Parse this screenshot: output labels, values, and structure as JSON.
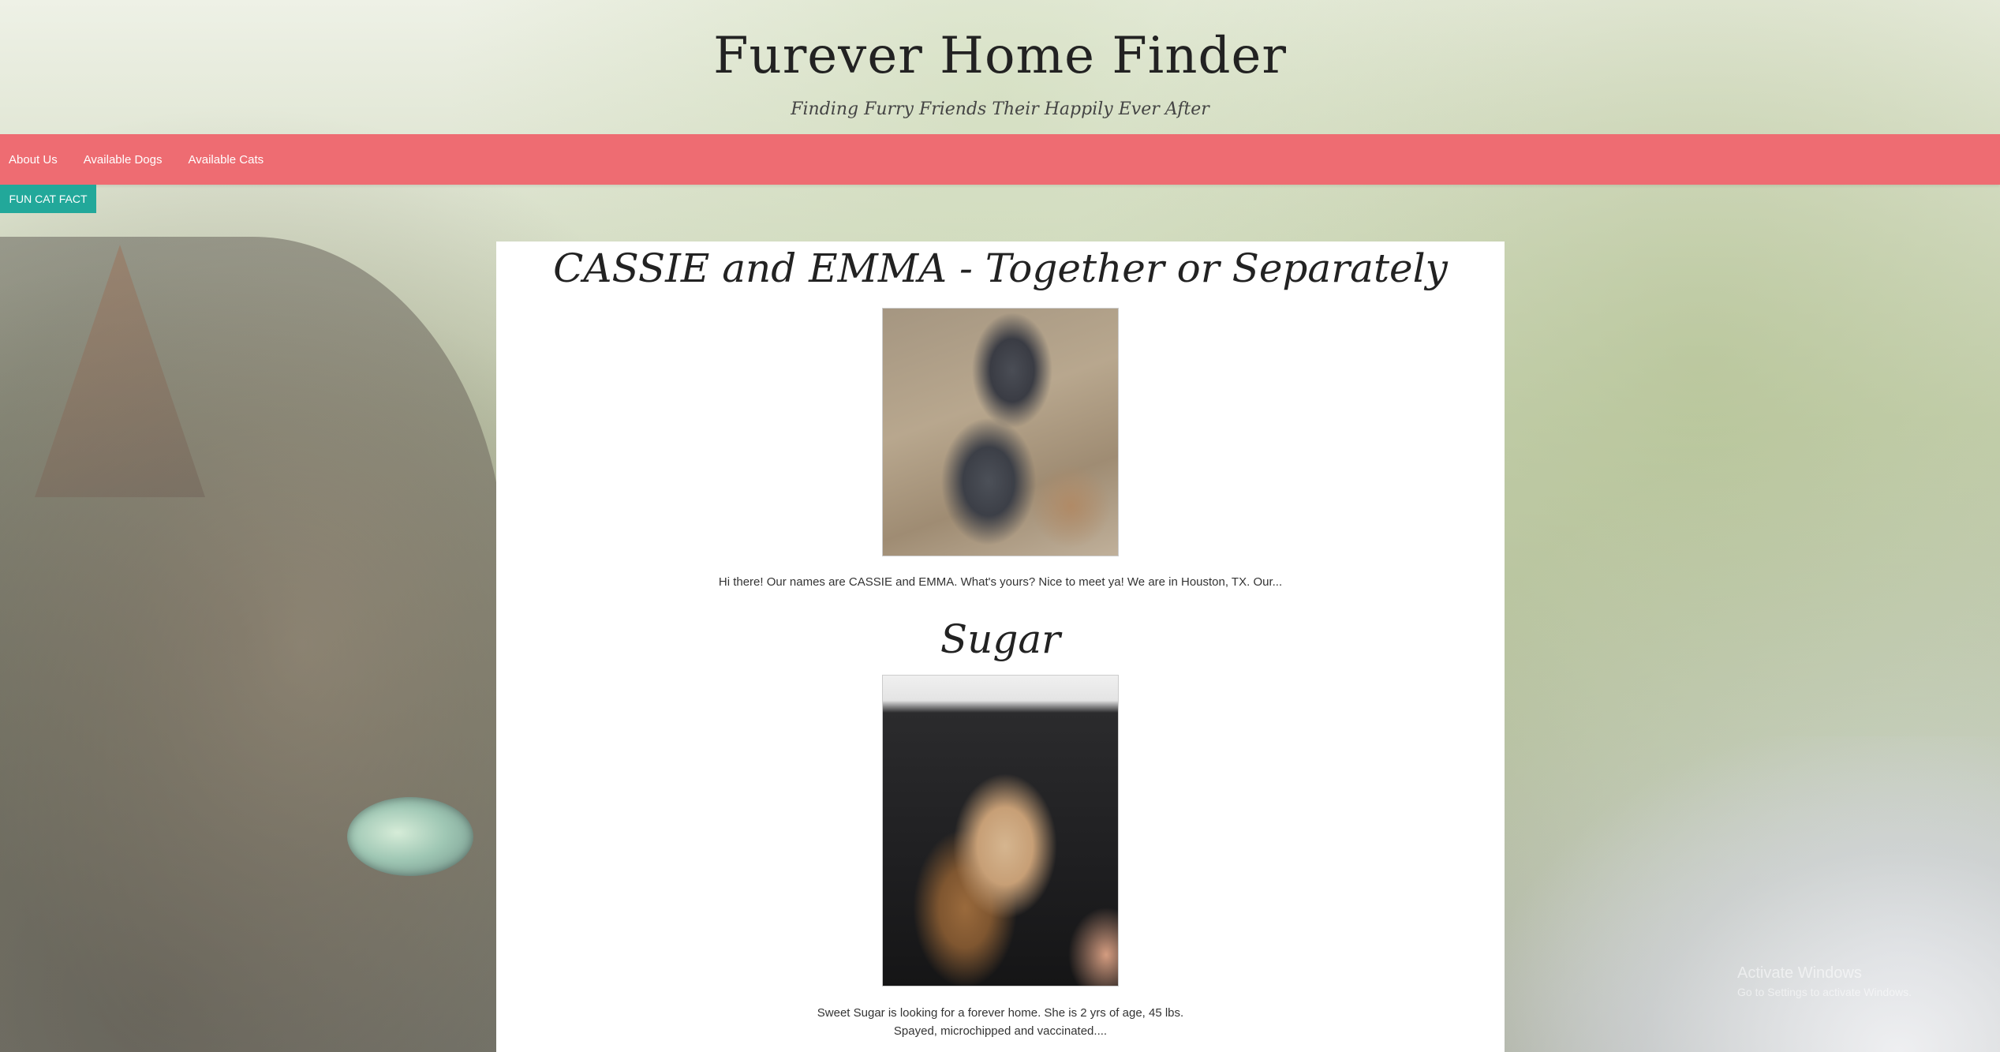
{
  "header": {
    "title": "Furever Home Finder",
    "tagline": "Finding Furry Friends Their Happily Ever After"
  },
  "nav": {
    "items": [
      {
        "label": "About Us"
      },
      {
        "label": "Available Dogs"
      },
      {
        "label": "Available Cats"
      }
    ]
  },
  "fact_button": {
    "label": "FUN CAT FACT"
  },
  "pets": [
    {
      "name": "CASSIE and EMMA - Together or Separately",
      "description": "Hi there! Our names are CASSIE and EMMA. What's yours? Nice to meet ya! We are in Houston, TX. Our..."
    },
    {
      "name": "Sugar",
      "description_line1": "Sweet Sugar is looking for a forever home. She is 2 yrs of age, 45 lbs.",
      "description_line2": "Spayed, microchipped and vaccinated...."
    }
  ],
  "watermark": {
    "line1": "Activate Windows",
    "line2": "Go to Settings to activate Windows."
  }
}
